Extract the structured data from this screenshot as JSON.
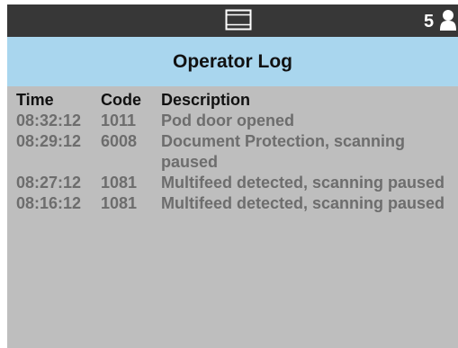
{
  "status_bar": {
    "scanner_icon": "scanner-icon",
    "count": "5",
    "user_icon": "user-icon"
  },
  "header": {
    "title": "Operator Log"
  },
  "log": {
    "columns": {
      "time": "Time",
      "code": "Code",
      "description": "Description"
    },
    "entries": [
      {
        "time": "08:32:12",
        "code": "1011",
        "description": "Pod door opened"
      },
      {
        "time": "08:29:12",
        "code": "6008",
        "description": "Document Protection, scanning paused"
      },
      {
        "time": "08:27:12",
        "code": "1081",
        "description": "Multifeed detected, scanning paused"
      },
      {
        "time": "08:16:12",
        "code": "1081",
        "description": "Multifeed detected, scanning paused"
      }
    ]
  },
  "colors": {
    "top_bar": "#373737",
    "title_bar": "#a9d6ee",
    "panel_bg": "#bebebe",
    "entry_text": "#6d6d6d"
  }
}
